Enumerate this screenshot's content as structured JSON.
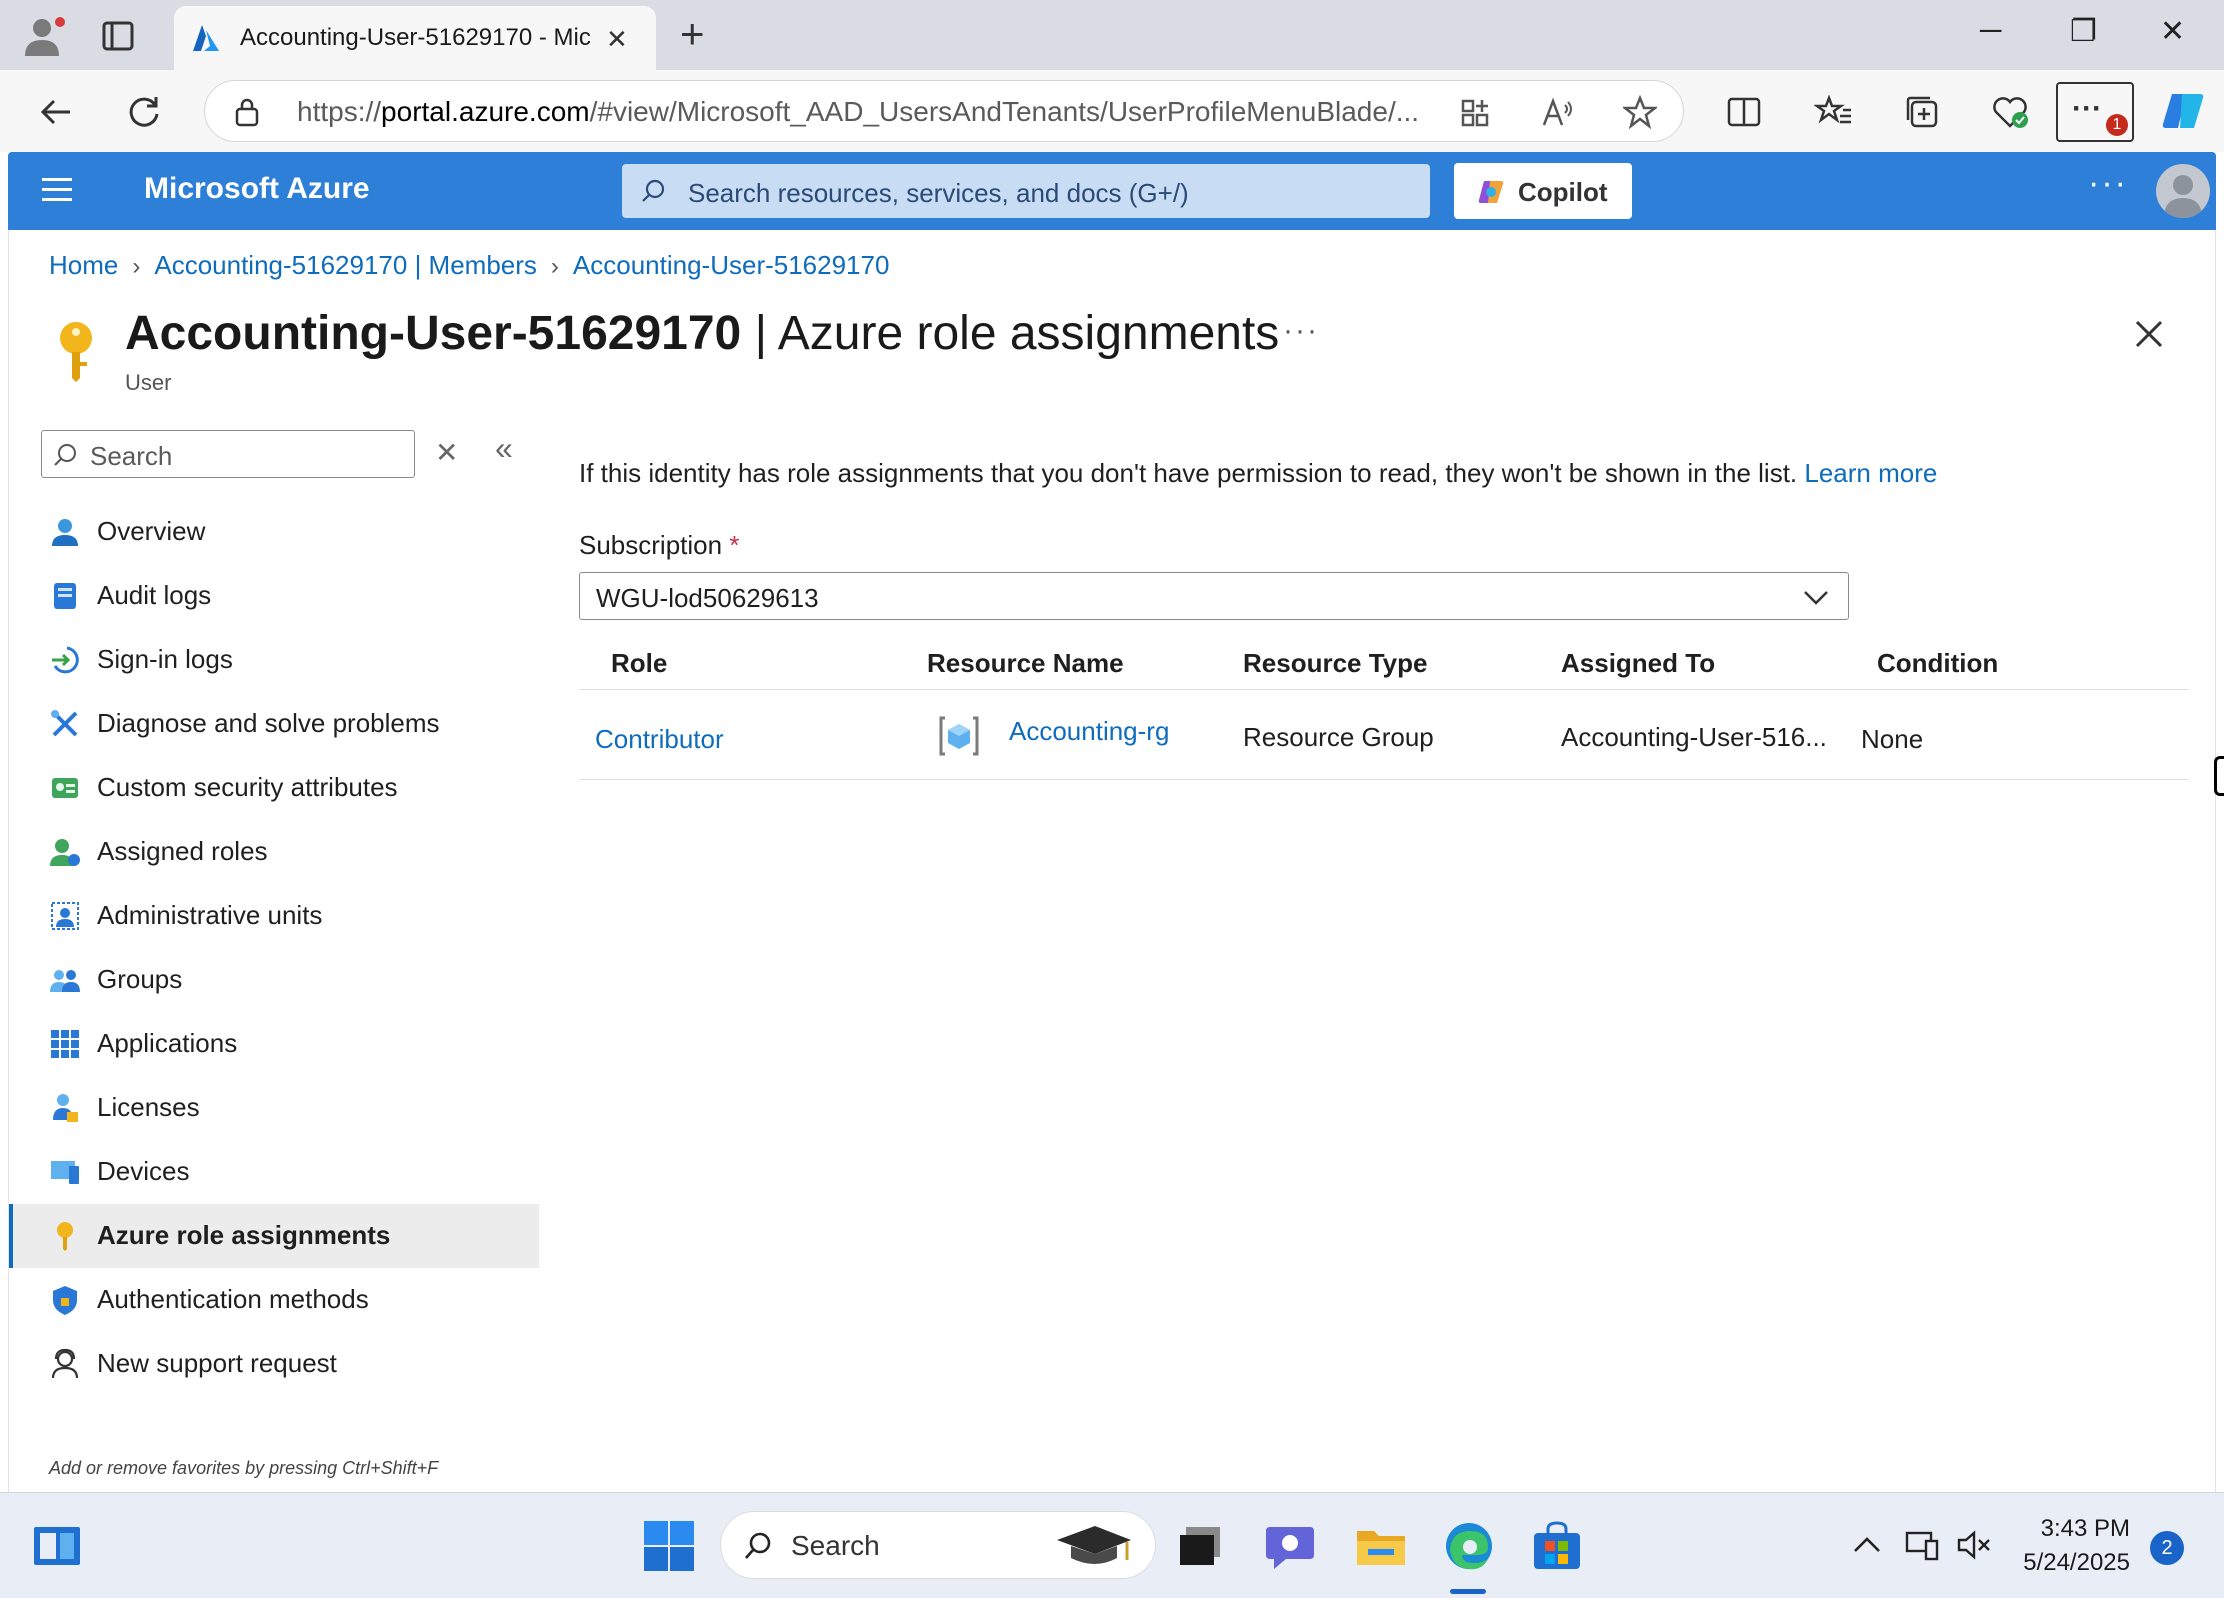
{
  "browser": {
    "tab_title": "Accounting-User-51629170 - Microsoft Azure",
    "url_scheme": "https://",
    "url_host": "portal.azure.com",
    "url_rest": "/#view/Microsoft_AAD_UsersAndTenants/UserProfileMenuBlade/...",
    "window_controls": {
      "minimize": "─",
      "restore": "❐",
      "close": "✕"
    },
    "extensions_badge": "1"
  },
  "azure": {
    "brand": "Microsoft Azure",
    "search_placeholder": "Search resources, services, and docs (G+/)",
    "copilot_label": "Copilot",
    "more": "···",
    "accent_color": "#2d7fd8"
  },
  "breadcrumb": [
    {
      "label": "Home"
    },
    {
      "label": "Accounting-51629170 | Members"
    },
    {
      "label": "Accounting-User-51629170"
    }
  ],
  "page": {
    "title_bold": "Accounting-User-51629170",
    "title_rest": " | Azure role assignments",
    "subtitle": "User",
    "more": "···"
  },
  "sidebar": {
    "search_placeholder": "Search",
    "clear": "✕",
    "collapse": "«",
    "items": [
      {
        "label": "Overview",
        "icon": "user-icon"
      },
      {
        "label": "Audit logs",
        "icon": "audit-log-icon"
      },
      {
        "label": "Sign-in logs",
        "icon": "sign-in-icon"
      },
      {
        "label": "Diagnose and solve problems",
        "icon": "wrench-icon"
      },
      {
        "label": "Custom security attributes",
        "icon": "attributes-icon"
      },
      {
        "label": "Assigned roles",
        "icon": "role-user-icon"
      },
      {
        "label": "Administrative units",
        "icon": "admin-units-icon"
      },
      {
        "label": "Groups",
        "icon": "groups-icon"
      },
      {
        "label": "Applications",
        "icon": "apps-grid-icon"
      },
      {
        "label": "Licenses",
        "icon": "license-icon"
      },
      {
        "label": "Devices",
        "icon": "devices-icon"
      },
      {
        "label": "Azure role assignments",
        "icon": "key-icon",
        "active": true
      },
      {
        "label": "Authentication methods",
        "icon": "shield-icon"
      },
      {
        "label": "New support request",
        "icon": "support-icon"
      }
    ],
    "favorites_hint": "Add or remove favorites by pressing Ctrl+Shift+F"
  },
  "main": {
    "info_text": "If this identity has role assignments that you don't have permission to read, they won't be shown in the list.",
    "learn_more": "Learn more",
    "subscription_label": "Subscription",
    "required_mark": "*",
    "subscription_value": "WGU-lod50629613",
    "columns": [
      "Role",
      "Resource Name",
      "Resource Type",
      "Assigned To",
      "Condition"
    ],
    "rows": [
      {
        "role": "Contributor",
        "resource_name": "Accounting-rg",
        "resource_type": "Resource Group",
        "assigned_to": "Accounting-User-516...",
        "condition": "None"
      }
    ]
  },
  "taskbar": {
    "search_label": "Search",
    "time": "3:43 PM",
    "date": "5/24/2025",
    "notification_count": "2"
  }
}
